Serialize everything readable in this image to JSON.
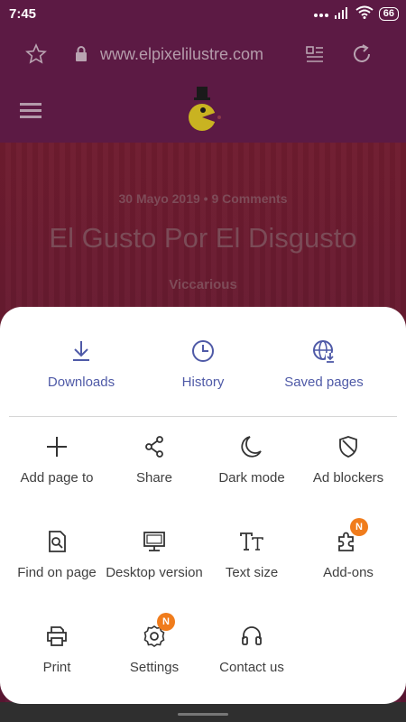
{
  "status_bar": {
    "time": "7:45",
    "battery": "66"
  },
  "browser": {
    "url": "www.elpixelilustre.com"
  },
  "article": {
    "meta": "30 Mayo 2019 • 9 Comments",
    "title": "El Gusto Por El Disgusto",
    "author": "Viccarious"
  },
  "menu": {
    "top": [
      {
        "label": "Downloads",
        "icon": "download-icon"
      },
      {
        "label": "History",
        "icon": "history-icon"
      },
      {
        "label": "Saved pages",
        "icon": "saved-pages-icon"
      }
    ],
    "grid": [
      {
        "label": "Add page to",
        "icon": "plus-icon"
      },
      {
        "label": "Share",
        "icon": "share-icon"
      },
      {
        "label": "Dark mode",
        "icon": "moon-icon"
      },
      {
        "label": "Ad blockers",
        "icon": "shield-icon"
      },
      {
        "label": "Find on page",
        "icon": "find-page-icon"
      },
      {
        "label": "Desktop version",
        "icon": "desktop-icon"
      },
      {
        "label": "Text size",
        "icon": "text-size-icon"
      },
      {
        "label": "Add-ons",
        "icon": "puzzle-icon",
        "badge": "N"
      },
      {
        "label": "Print",
        "icon": "print-icon"
      },
      {
        "label": "Settings",
        "icon": "gear-icon",
        "badge": "N"
      },
      {
        "label": "Contact us",
        "icon": "headset-icon"
      }
    ]
  },
  "colors": {
    "accent": "#4f5aa7",
    "badge": "#f07c1c",
    "scrim_top": "#5c1a44"
  }
}
